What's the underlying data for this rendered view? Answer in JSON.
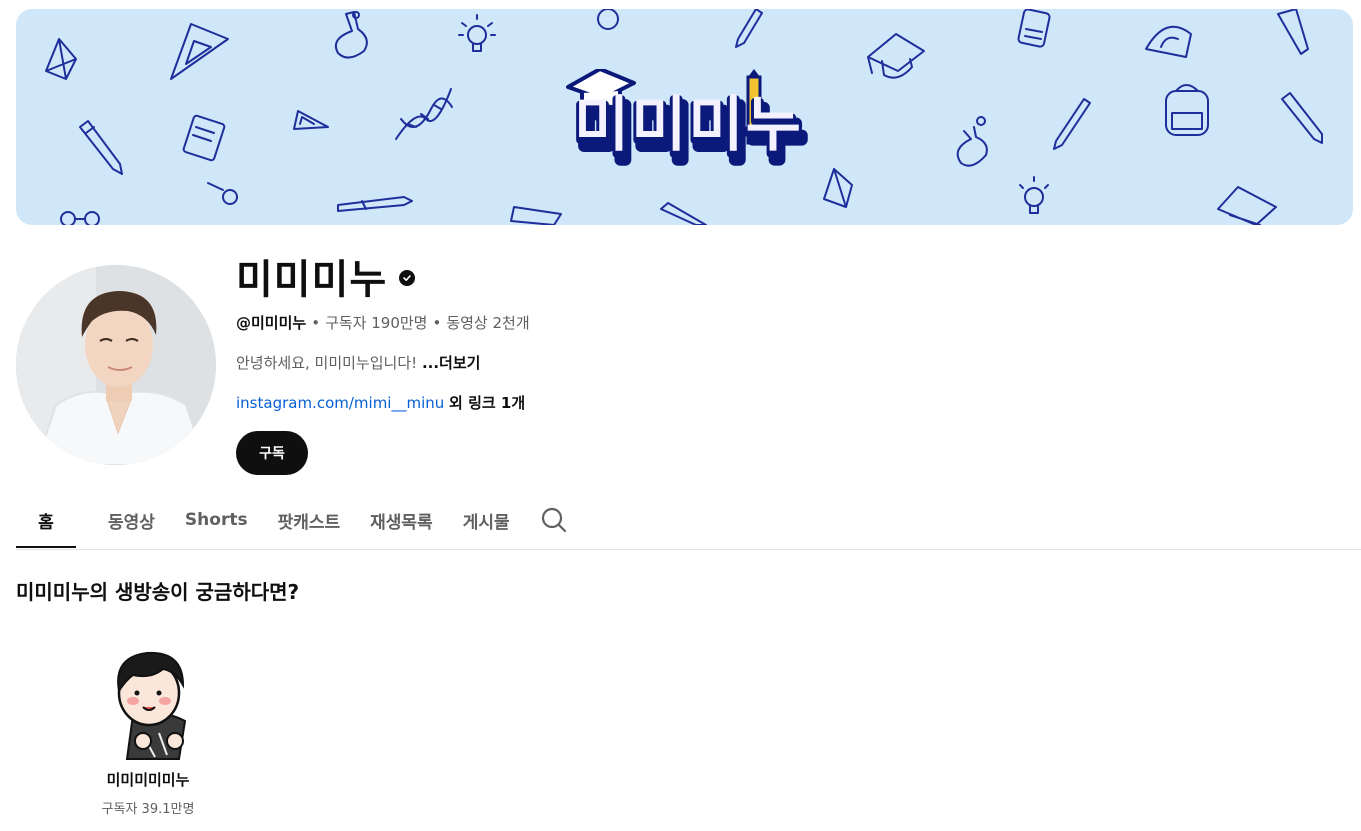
{
  "banner": {
    "logo_text": "미미미누"
  },
  "channel": {
    "name": "미미미누",
    "handle": "@미미미누",
    "subscribers": "구독자 190만명",
    "videos": "동영상 2천개",
    "separator": "•",
    "description": "안녕하세요, 미미미누입니다!",
    "more_label": "...더보기",
    "link_text": "instagram.com/mimi__minu",
    "extra_links": "외 링크 1개",
    "subscribe_label": "구독"
  },
  "tabs": [
    {
      "label": "홈",
      "active": true
    },
    {
      "label": "동영상",
      "active": false
    },
    {
      "label": "Shorts",
      "active": false
    },
    {
      "label": "팟캐스트",
      "active": false
    },
    {
      "label": "재생목록",
      "active": false
    },
    {
      "label": "게시물",
      "active": false
    }
  ],
  "section": {
    "title": "미미미누의 생방송이 궁금하다면?",
    "featured_channel": {
      "name": "미미미미미누",
      "subscribers": "구독자 39.1만명"
    }
  },
  "colors": {
    "banner_bg": "#cfe7f8",
    "doodle": "#1e2f9c",
    "link": "#065fd4",
    "text_primary": "#0f0f0f",
    "text_secondary": "#606060"
  }
}
